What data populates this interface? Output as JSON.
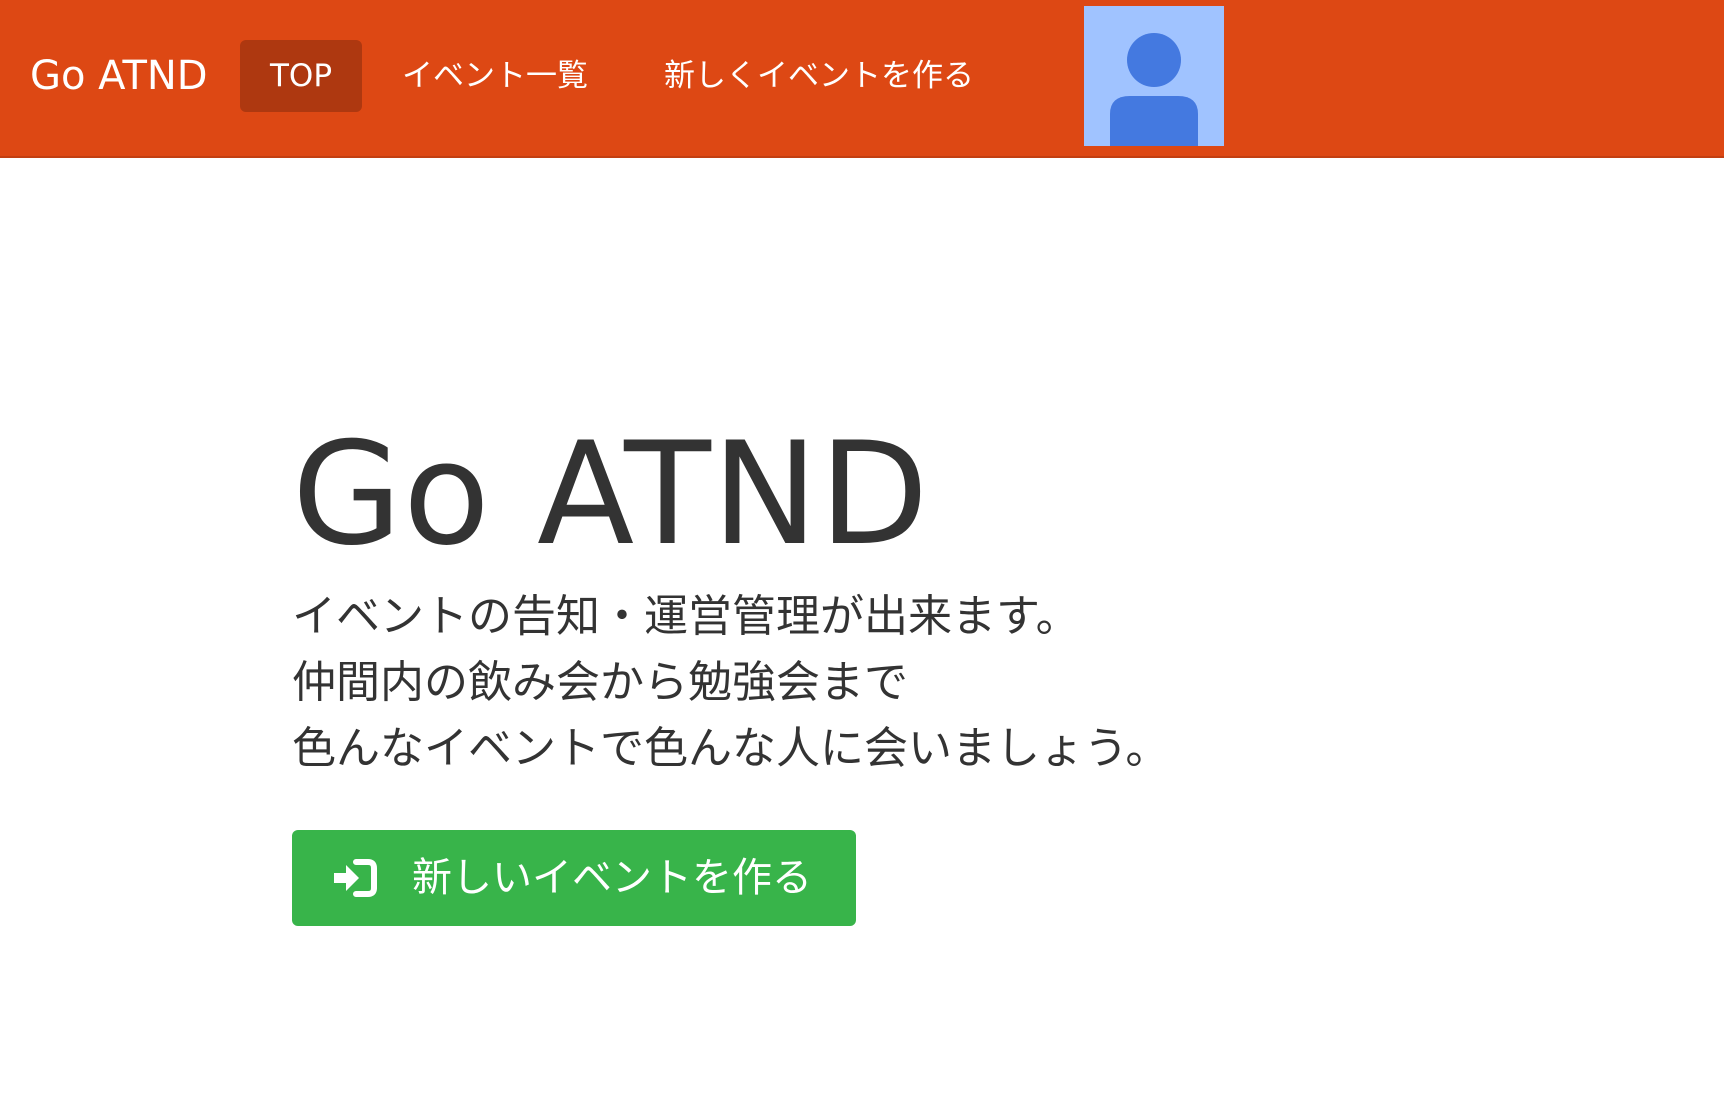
{
  "navbar": {
    "brand": "Go ATND",
    "items": [
      {
        "label": "TOP",
        "active": true
      },
      {
        "label": "イベント一覧"
      },
      {
        "label": "新しくイベントを作る"
      }
    ],
    "colors": {
      "background": "#dd4814",
      "active_item": "#ae3810"
    },
    "avatar_icon": "user-avatar-icon"
  },
  "hero": {
    "title": "Go ATND",
    "lines": [
      "イベントの告知・運営管理が出来ます。",
      "仲間内の飲み会から勉強会まで",
      "色んなイベントで色んな人に会いましょう。"
    ]
  },
  "cta": {
    "label": "新しいイベントを作る",
    "icon": "sign-in-icon",
    "color": "#38b44a"
  }
}
